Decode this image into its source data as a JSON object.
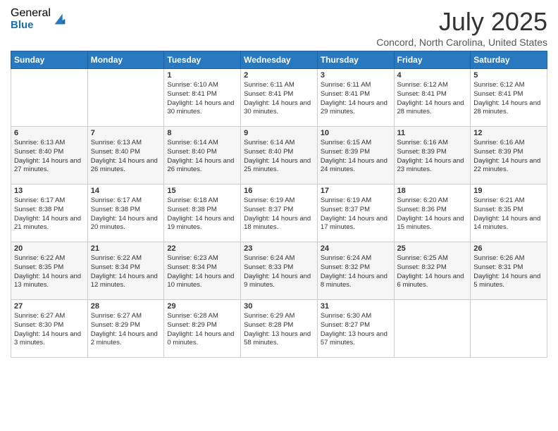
{
  "logo": {
    "general": "General",
    "blue": "Blue"
  },
  "title": "July 2025",
  "location": "Concord, North Carolina, United States",
  "days_of_week": [
    "Sunday",
    "Monday",
    "Tuesday",
    "Wednesday",
    "Thursday",
    "Friday",
    "Saturday"
  ],
  "weeks": [
    [
      {
        "day": "",
        "info": ""
      },
      {
        "day": "",
        "info": ""
      },
      {
        "day": "1",
        "sunrise": "6:10 AM",
        "sunset": "8:41 PM",
        "daylight": "14 hours and 30 minutes."
      },
      {
        "day": "2",
        "sunrise": "6:11 AM",
        "sunset": "8:41 PM",
        "daylight": "14 hours and 30 minutes."
      },
      {
        "day": "3",
        "sunrise": "6:11 AM",
        "sunset": "8:41 PM",
        "daylight": "14 hours and 29 minutes."
      },
      {
        "day": "4",
        "sunrise": "6:12 AM",
        "sunset": "8:41 PM",
        "daylight": "14 hours and 28 minutes."
      },
      {
        "day": "5",
        "sunrise": "6:12 AM",
        "sunset": "8:41 PM",
        "daylight": "14 hours and 28 minutes."
      }
    ],
    [
      {
        "day": "6",
        "sunrise": "6:13 AM",
        "sunset": "8:40 PM",
        "daylight": "14 hours and 27 minutes."
      },
      {
        "day": "7",
        "sunrise": "6:13 AM",
        "sunset": "8:40 PM",
        "daylight": "14 hours and 26 minutes."
      },
      {
        "day": "8",
        "sunrise": "6:14 AM",
        "sunset": "8:40 PM",
        "daylight": "14 hours and 26 minutes."
      },
      {
        "day": "9",
        "sunrise": "6:14 AM",
        "sunset": "8:40 PM",
        "daylight": "14 hours and 25 minutes."
      },
      {
        "day": "10",
        "sunrise": "6:15 AM",
        "sunset": "8:39 PM",
        "daylight": "14 hours and 24 minutes."
      },
      {
        "day": "11",
        "sunrise": "6:16 AM",
        "sunset": "8:39 PM",
        "daylight": "14 hours and 23 minutes."
      },
      {
        "day": "12",
        "sunrise": "6:16 AM",
        "sunset": "8:39 PM",
        "daylight": "14 hours and 22 minutes."
      }
    ],
    [
      {
        "day": "13",
        "sunrise": "6:17 AM",
        "sunset": "8:38 PM",
        "daylight": "14 hours and 21 minutes."
      },
      {
        "day": "14",
        "sunrise": "6:17 AM",
        "sunset": "8:38 PM",
        "daylight": "14 hours and 20 minutes."
      },
      {
        "day": "15",
        "sunrise": "6:18 AM",
        "sunset": "8:38 PM",
        "daylight": "14 hours and 19 minutes."
      },
      {
        "day": "16",
        "sunrise": "6:19 AM",
        "sunset": "8:37 PM",
        "daylight": "14 hours and 18 minutes."
      },
      {
        "day": "17",
        "sunrise": "6:19 AM",
        "sunset": "8:37 PM",
        "daylight": "14 hours and 17 minutes."
      },
      {
        "day": "18",
        "sunrise": "6:20 AM",
        "sunset": "8:36 PM",
        "daylight": "14 hours and 15 minutes."
      },
      {
        "day": "19",
        "sunrise": "6:21 AM",
        "sunset": "8:35 PM",
        "daylight": "14 hours and 14 minutes."
      }
    ],
    [
      {
        "day": "20",
        "sunrise": "6:22 AM",
        "sunset": "8:35 PM",
        "daylight": "14 hours and 13 minutes."
      },
      {
        "day": "21",
        "sunrise": "6:22 AM",
        "sunset": "8:34 PM",
        "daylight": "14 hours and 12 minutes."
      },
      {
        "day": "22",
        "sunrise": "6:23 AM",
        "sunset": "8:34 PM",
        "daylight": "14 hours and 10 minutes."
      },
      {
        "day": "23",
        "sunrise": "6:24 AM",
        "sunset": "8:33 PM",
        "daylight": "14 hours and 9 minutes."
      },
      {
        "day": "24",
        "sunrise": "6:24 AM",
        "sunset": "8:32 PM",
        "daylight": "14 hours and 8 minutes."
      },
      {
        "day": "25",
        "sunrise": "6:25 AM",
        "sunset": "8:32 PM",
        "daylight": "14 hours and 6 minutes."
      },
      {
        "day": "26",
        "sunrise": "6:26 AM",
        "sunset": "8:31 PM",
        "daylight": "14 hours and 5 minutes."
      }
    ],
    [
      {
        "day": "27",
        "sunrise": "6:27 AM",
        "sunset": "8:30 PM",
        "daylight": "14 hours and 3 minutes."
      },
      {
        "day": "28",
        "sunrise": "6:27 AM",
        "sunset": "8:29 PM",
        "daylight": "14 hours and 2 minutes."
      },
      {
        "day": "29",
        "sunrise": "6:28 AM",
        "sunset": "8:29 PM",
        "daylight": "14 hours and 0 minutes."
      },
      {
        "day": "30",
        "sunrise": "6:29 AM",
        "sunset": "8:28 PM",
        "daylight": "13 hours and 58 minutes."
      },
      {
        "day": "31",
        "sunrise": "6:30 AM",
        "sunset": "8:27 PM",
        "daylight": "13 hours and 57 minutes."
      },
      {
        "day": "",
        "info": ""
      },
      {
        "day": "",
        "info": ""
      }
    ]
  ]
}
